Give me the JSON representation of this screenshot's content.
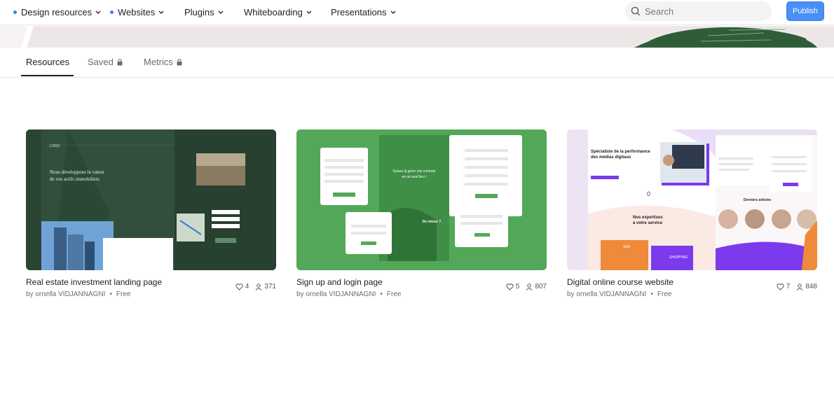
{
  "nav": {
    "items": [
      {
        "label": "Design resources",
        "dot": true
      },
      {
        "label": "Websites",
        "dot": true
      },
      {
        "label": "Plugins",
        "dot": false
      },
      {
        "label": "Whiteboarding",
        "dot": false
      },
      {
        "label": "Presentations",
        "dot": false
      }
    ],
    "search_placeholder": "Search",
    "publish_label": "Publish"
  },
  "tabs": [
    {
      "label": "Resources",
      "active": true,
      "locked": false
    },
    {
      "label": "Saved",
      "active": false,
      "locked": true
    },
    {
      "label": "Metrics",
      "active": false,
      "locked": true
    }
  ],
  "cards": [
    {
      "title": "Real estate investment landing page",
      "author": "by ornella VIDJANNAGNI",
      "price": "Free",
      "likes": "4",
      "users": "371",
      "thumb_texts": {
        "logo": "LOGO",
        "headline_1": "Nous développons la valeur",
        "headline_2": "de vos actifs immobiliers"
      }
    },
    {
      "title": "Sign up and login page",
      "author": "by ornella VIDJANNAGNI",
      "price": "Free",
      "likes": "5",
      "users": "807",
      "thumb_texts": {
        "heading_1": "Suivez & gérer vos contrats",
        "heading_2": "en un seul lieu !",
        "return": "De retour ?"
      }
    },
    {
      "title": "Digital online course website",
      "author": "by ornella VIDJANNAGNI",
      "price": "Free",
      "likes": "7",
      "users": "848",
      "thumb_texts": {
        "hero_1": "Spécialiste de la performance",
        "hero_2": "des médias digitaux",
        "zero": "0",
        "expertises_1": "Nos expertises",
        "expertises_2": "à votre service",
        "articles": "Derniers articles",
        "seo": "SEA",
        "shopping": "SHOPPING"
      }
    }
  ],
  "colors": {
    "accent": "#4a8ff7",
    "nav_dot": "#3b82f6",
    "card1_bg": "#2c4a37",
    "card2_bg": "#4fa656",
    "card3_purple": "#7c3aed",
    "card3_orange": "#ee8a3a"
  }
}
